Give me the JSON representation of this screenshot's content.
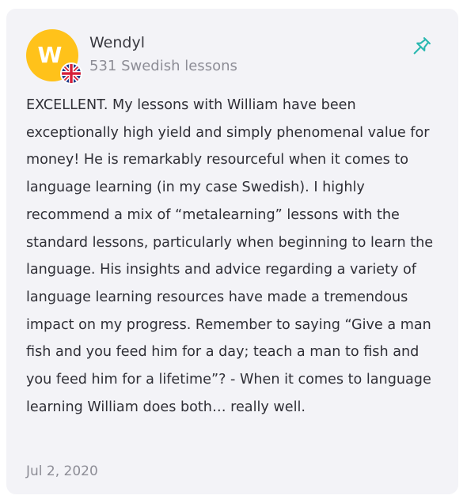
{
  "review": {
    "author": {
      "name": "Wendyl",
      "initial": "W",
      "lessons": "531 Swedish lessons",
      "avatar_color": "#ffc21a",
      "flag_icon": "uk-flag-icon"
    },
    "pin_icon": "pin-icon",
    "pin_color": "#2ab8b0",
    "text": "EXCELLENT. My lessons with William have been exceptionally high yield and simply phenomenal value for money! He is remarkably resourceful when it comes to language learning (in my case Swedish). I highly recommend a mix of “metalearning” lessons with the standard lessons, particularly when beginning to learn the language. His insights and advice regarding a variety of language learning resources have made a tremendous impact on my progress. Remember to saying “Give a man fish and you feed him for a day; teach a man to fish and you feed him for a lifetime”? - When it comes to language learning William does both… really well.",
    "date": "Jul 2, 2020"
  }
}
